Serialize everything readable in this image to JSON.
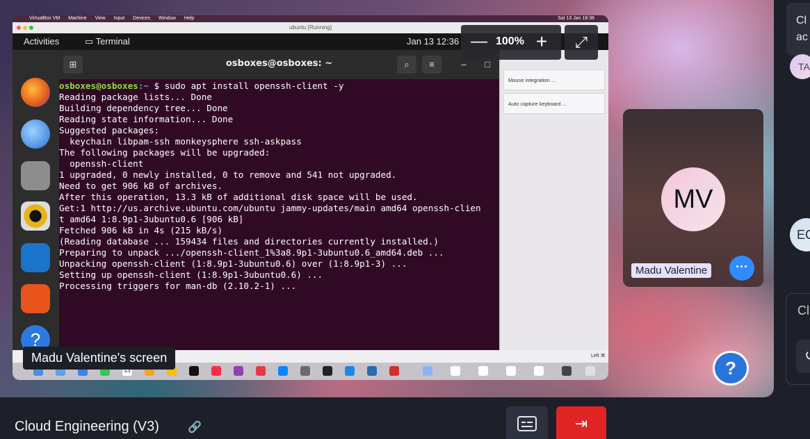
{
  "colors": {
    "leave": "#e02424",
    "accent": "#2f8cff",
    "terminal_bg": "#300a24",
    "prompt_user": "#8ae234",
    "prompt_path": "#729fcf"
  },
  "side_panel": {
    "toast_text_1": "Cl",
    "toast_text_2": "ac",
    "avatar_initials_1": "TA",
    "avatar_initials_2": "EC",
    "card_label": "Cl"
  },
  "shared_screen": {
    "screen_label": "Madu Valentine's screen",
    "mac_menu": [
      "VirtualBox VM",
      "Machine",
      "View",
      "Input",
      "Devices",
      "Window",
      "Help"
    ],
    "mac_clock": "Sat 13 Jan 18:36",
    "window_title": "ubuntu [Running]",
    "gnome": {
      "activities": "Activities",
      "app": "Terminal",
      "clock": "Jan 13  12:36"
    },
    "zoom": {
      "minus": "—",
      "percent": "100%",
      "plus": "+"
    },
    "terminal": {
      "title": "osboxes@osboxes: ~",
      "prompt_user": "osboxes@osboxes",
      "prompt_path": ":~",
      "command": "$ sudo apt install openssh-client -y",
      "output": [
        "Reading package lists... Done",
        "Building dependency tree... Done",
        "Reading state information... Done",
        "Suggested packages:",
        "  keychain libpam-ssh monkeysphere ssh-askpass",
        "The following packages will be upgraded:",
        "  openssh-client",
        "1 upgraded, 0 newly installed, 0 to remove and 541 not upgraded.",
        "Need to get 906 kB of archives.",
        "After this operation, 13.3 kB of additional disk space will be used.",
        "Get:1 http://us.archive.ubuntu.com/ubuntu jammy-updates/main amd64 openssh-clien",
        "t amd64 1:8.9p1-3ubuntu0.6 [906 kB]",
        "Fetched 906 kB in 4s (215 kB/s)",
        "(Reading database ... 159434 files and directories currently installed.)",
        "Preparing to unpack .../openssh-client_1%3a8.9p1-3ubuntu0.6_amd64.deb ...",
        "Unpacking openssh-client (1:8.9p1-3ubuntu0.6) over (1:8.9p1-3) ...",
        "Setting up openssh-client (1:8.9p1-3ubuntu0.6) ...",
        "Processing triggers for man-db (2.10.2-1) ..."
      ]
    },
    "notices": [
      "Mouse integration ...",
      "Auto capture keyboard ..."
    ],
    "status_left": "Left ⌘",
    "mac_dock_date": "13"
  },
  "participant": {
    "initials": "MV",
    "name": "Madu Valentine",
    "more": "···"
  },
  "help": "?",
  "bottom": {
    "meeting_title": "Cloud Engineering (V3)"
  }
}
